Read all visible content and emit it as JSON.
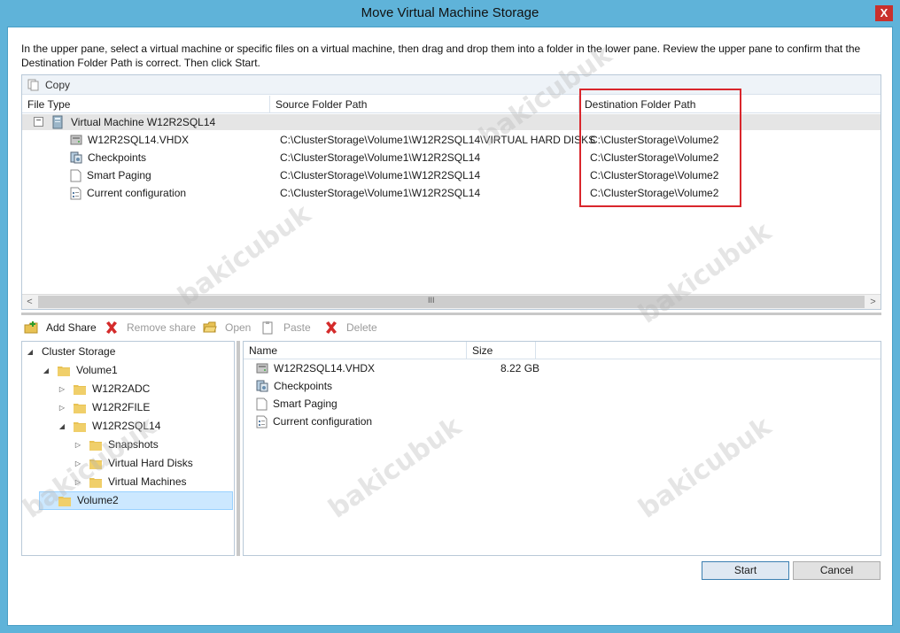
{
  "window": {
    "title": "Move Virtual Machine Storage",
    "close_glyph": "X"
  },
  "instructions": "In the upper pane, select a virtual machine or specific files on a virtual machine, then drag and drop them into a folder in the lower pane.  Review the upper pane to confirm that the Destination Folder Path is correct. Then click Start.",
  "upper": {
    "copy_label": "Copy",
    "columns": [
      "File Type",
      "Source Folder Path",
      "Destination Folder Path"
    ],
    "vm_label": "Virtual Machine W12R2SQL14",
    "vm_toggle": "−",
    "rows": [
      {
        "name": "W12R2SQL14.VHDX",
        "icon": "disk-icon",
        "source": "C:\\ClusterStorage\\Volume1\\W12R2SQL14\\VIRTUAL HARD DISKS",
        "dest": "C:\\ClusterStorage\\Volume2"
      },
      {
        "name": "Checkpoints",
        "icon": "checkpoints-icon",
        "source": "C:\\ClusterStorage\\Volume1\\W12R2SQL14",
        "dest": "C:\\ClusterStorage\\Volume2"
      },
      {
        "name": "Smart Paging",
        "icon": "page-icon",
        "source": "C:\\ClusterStorage\\Volume1\\W12R2SQL14",
        "dest": "C:\\ClusterStorage\\Volume2"
      },
      {
        "name": "Current configuration",
        "icon": "config-icon",
        "source": "C:\\ClusterStorage\\Volume1\\W12R2SQL14",
        "dest": "C:\\ClusterStorage\\Volume2"
      }
    ],
    "scroll_left": "<",
    "scroll_right": ">",
    "scroll_grip": "III"
  },
  "lower_toolbar": {
    "add_share": "Add Share",
    "remove_share": "Remove share",
    "open": "Open",
    "paste": "Paste",
    "delete": "Delete"
  },
  "tree": {
    "root": "Cluster Storage",
    "volume1": "Volume1",
    "w12r2adc": "W12R2ADC",
    "w12r2file": "W12R2FILE",
    "w12r2sql14": "W12R2SQL14",
    "snapshots": "Snapshots",
    "virtual_hard_disks": "Virtual Hard Disks",
    "virtual_machines": "Virtual Machines",
    "volume2": "Volume2",
    "expanded_glyph": "◢",
    "collapsed_glyph": "▷"
  },
  "list": {
    "columns": [
      "Name",
      "Size"
    ],
    "items": [
      {
        "name": "W12R2SQL14.VHDX",
        "size": "8.22 GB"
      },
      {
        "name": "Checkpoints",
        "size": ""
      },
      {
        "name": "Smart Paging",
        "size": ""
      },
      {
        "name": "Current configuration",
        "size": ""
      }
    ]
  },
  "buttons": {
    "start": "Start",
    "cancel": "Cancel"
  },
  "watermark": "bakicubuk",
  "colors": {
    "window_frame": "#5fb3d9",
    "highlight_box": "#d9262c",
    "selected_row": "#cce8ff",
    "folder": "#e8c254"
  }
}
